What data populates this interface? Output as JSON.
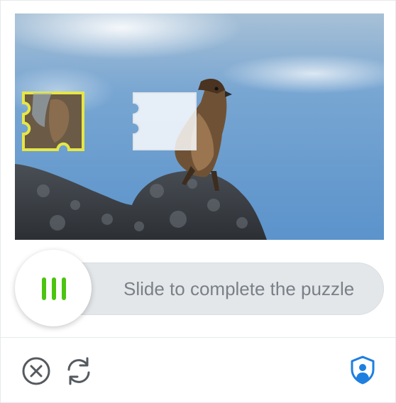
{
  "slider": {
    "hint": "Slide to complete the puzzle",
    "position": 0
  },
  "puzzle": {
    "image": "sparrow-on-rock"
  },
  "footer": {
    "close_icon": "close-circle-icon",
    "refresh_icon": "refresh-icon",
    "shield_icon": "shield-user-icon"
  },
  "colors": {
    "accent_green": "#4cc410",
    "piece_outline": "#e6e645",
    "shield_blue": "#1e7fe0",
    "icon_gray": "#555a60"
  }
}
